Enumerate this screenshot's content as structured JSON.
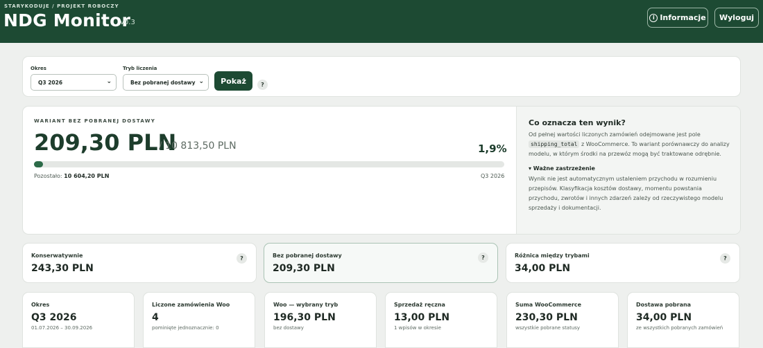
{
  "header": {
    "eyebrow": "STARYKODUJE / PROJEKT ROBOCZY",
    "title": "NDG Monitor",
    "version": "v0.3",
    "info_button": "Informacje",
    "info_icon": "i",
    "logout_button": "Wyloguj"
  },
  "filters": {
    "period_label": "Okres",
    "period_value": "Q3 2026",
    "mode_label": "Tryb liczenia",
    "mode_value": "Bez pobranej dostawy",
    "show_button": "Pokaż",
    "help": "?"
  },
  "result": {
    "eyebrow": "WARIANT BEZ POBRANEJ DOSTAWY",
    "value": "209,30 PLN",
    "total": "/ 10 813,50 PLN",
    "percent": "1,9%",
    "progress_fraction": 0.019,
    "remaining_label": "Pozostało:",
    "remaining_value": "10 604,20 PLN",
    "period": "Q3 2026"
  },
  "explanation": {
    "title": "Co oznacza ten wynik?",
    "text_before": "Od pełnej wartości liczonych zamówień odejmowane jest pole",
    "code": "shipping_total",
    "text_after": "z WooCommerce. To wariant porównawczy do analizy modelu, w którym środki na przewóz mogą być traktowane odrębnie.",
    "warning_title": "▾ Ważne zastrzeżenie",
    "warning_text": "Wynik nie jest automatycznym ustaleniem przychodu w rozumieniu przepisów. Klasyfikacja kosztów dostawy, momentu powstania przychodu, zwrotów i innych zdarzeń zależy od rzeczywistego modelu sprzedaży i dokumentacji."
  },
  "modes": [
    {
      "label": "Konserwatywnie",
      "value": "243,30 PLN",
      "help": "?"
    },
    {
      "label": "Bez pobranej dostawy",
      "value": "209,30 PLN",
      "help": "?"
    },
    {
      "label": "Różnica między trybami",
      "value": "34,00 PLN",
      "help": "?"
    }
  ],
  "stats": [
    {
      "label": "Okres",
      "value": "Q3 2026",
      "sub": "01.07.2026 – 30.09.2026"
    },
    {
      "label": "Liczone zamówienia Woo",
      "value": "4",
      "sub": "pominięte jednoznacznie: 0"
    },
    {
      "label": "Woo — wybrany tryb",
      "value": "196,30 PLN",
      "sub": "bez dostawy"
    },
    {
      "label": "Sprzedaż ręczna",
      "value": "13,00 PLN",
      "sub": "1 wpisów w okresie"
    },
    {
      "label": "Suma WooCommerce",
      "value": "230,30 PLN",
      "sub": "wszystkie pobrane statusy"
    },
    {
      "label": "Dostawa pobrana",
      "value": "34,00 PLN",
      "sub": "ze wszystkich pobranych zamówień"
    }
  ]
}
